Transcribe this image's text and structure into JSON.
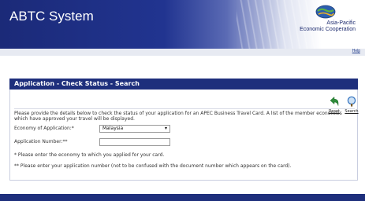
{
  "header": {
    "app_title": "ABTC System",
    "logo_line1": "Asia-Pacific",
    "logo_line2": "Economic Cooperation",
    "logo_icon": "apec-globe-icon"
  },
  "help": {
    "label": "Help"
  },
  "panel": {
    "title": "Application - Check Status - Search"
  },
  "toolbar": {
    "reset_label": "Reset",
    "reset_icon": "back-arrow-icon",
    "search_label": "Search",
    "search_icon": "magnifier-icon"
  },
  "intro": {
    "line1": "Please provide the details below to check the status of your application for an APEC Business Travel Card. A list of the member economies",
    "line2": "which have approved your travel will be displayed."
  },
  "form": {
    "economy_label": "Economy of Application:*",
    "economy_value": "Malaysia",
    "application_number_label": "Application Number:**",
    "application_number_value": ""
  },
  "notes": {
    "note1": "* Please enter the economy to which you applied for your card.",
    "note2": "** Please enter your application number (not to be confused with the document number which appears on the card)."
  },
  "colors": {
    "header_dark": "#1b2a78",
    "panel_header": "#1e2f7c",
    "reset_icon_green": "#2e8b3a",
    "search_icon_blue": "#3a78c2"
  }
}
